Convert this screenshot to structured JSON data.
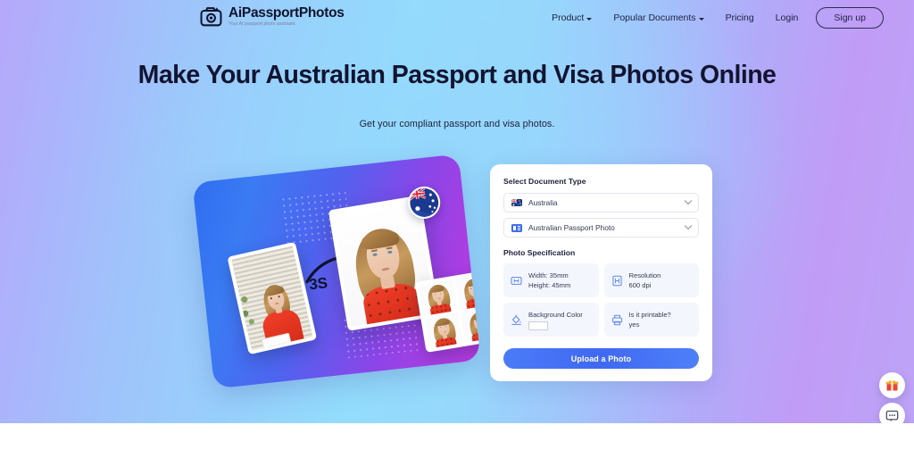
{
  "header": {
    "logo": {
      "icon": "camera-logo-icon",
      "title": "AiPassportPhotos",
      "tagline": "Your AI passport photo assistant."
    },
    "nav": [
      {
        "label": "Product",
        "has_dropdown": true
      },
      {
        "label": "Popular Documents",
        "has_dropdown": true
      },
      {
        "label": "Pricing",
        "has_dropdown": false
      },
      {
        "label": "Login",
        "has_dropdown": false
      }
    ],
    "signup_label": "Sign up"
  },
  "hero": {
    "headline": "Make Your Australian Passport and Visa Photos Online",
    "subhead": "Get your compliant passport and visa photos.",
    "illustration": {
      "speed_label": "3S",
      "flag_badge": "australia-flag-icon"
    }
  },
  "form": {
    "document_type_label": "Select Document Type",
    "country_select": {
      "value": "Australia",
      "icon": "australia-flag-icon"
    },
    "document_select": {
      "value": "Australian Passport Photo",
      "icon": "id-card-icon"
    },
    "spec_label": "Photo Specification",
    "specs": [
      {
        "icon": "dimensions-icon",
        "line1": "Width: 35mm",
        "line2": "Height: 45mm"
      },
      {
        "icon": "resolution-icon",
        "line1": "Resolution",
        "line2": "600 dpi"
      },
      {
        "icon": "paint-bucket-icon",
        "line1": "Background Color",
        "line2": "",
        "swatch": "#ffffff"
      },
      {
        "icon": "printer-icon",
        "line1": "Is it printable?",
        "line2": "yes"
      }
    ],
    "upload_label": "Upload a Photo"
  },
  "floating_actions": [
    {
      "name": "gift-icon"
    },
    {
      "name": "chat-icon"
    }
  ],
  "colors": {
    "accent_blue": "#4069f2",
    "headline_dark": "#121430",
    "panel_gradient_start": "#2f6df0",
    "panel_gradient_end": "#b93adf"
  }
}
